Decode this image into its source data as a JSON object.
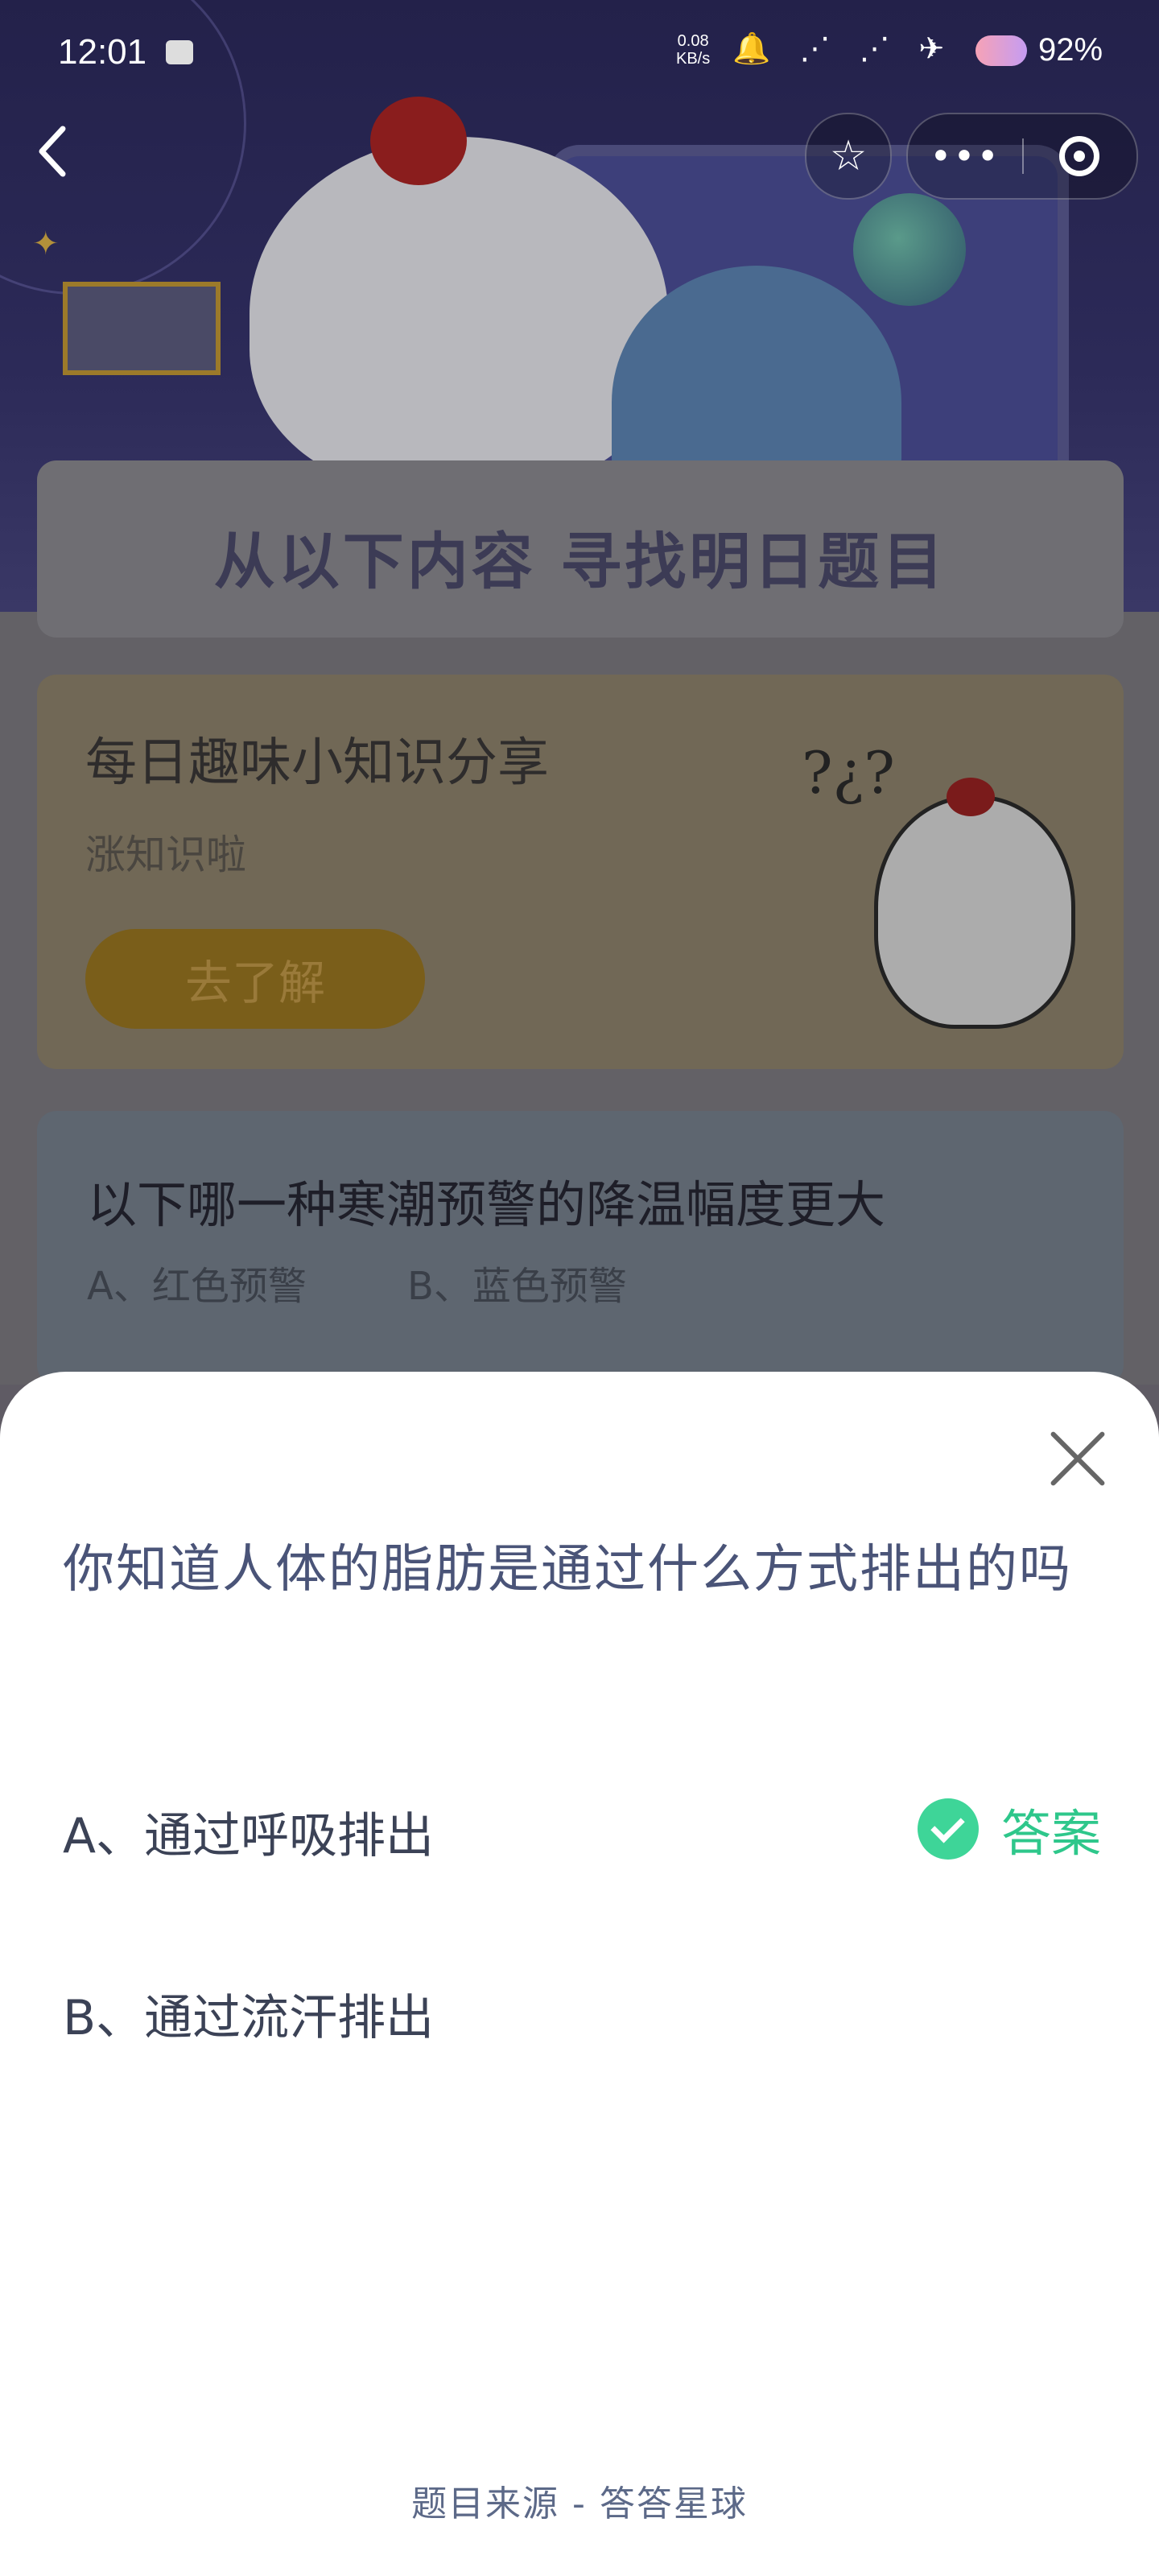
{
  "status_bar": {
    "time": "12:01",
    "net_speed_value": "0.08",
    "net_speed_unit": "KB/s",
    "battery": "92%"
  },
  "nav": {
    "back_icon": "chevron-left-icon",
    "favorite_icon": "star-icon",
    "more_icon": "more-dots-icon",
    "close_app_icon": "target-circle-icon"
  },
  "find_panel": {
    "title": "从以下内容 寻找明日题目"
  },
  "knowledge_card": {
    "title": "每日趣味小知识分享",
    "subtitle": "涨知识啦",
    "button_label": "去了解"
  },
  "question_card": {
    "question": "以下哪一种寒潮预警的降温幅度更大",
    "option_a": "A、红色预警",
    "option_b": "B、蓝色预警"
  },
  "answer_sheet": {
    "question": "你知道人体的脂肪是通过什么方式排出的吗",
    "options": [
      {
        "label": "A、通过呼吸排出",
        "is_answer": true
      },
      {
        "label": "B、通过流汗排出",
        "is_answer": false
      }
    ],
    "answer_tag": "答案",
    "source": "题目来源 - 答答星球"
  },
  "colors": {
    "accent_green": "#3ed598",
    "question_text": "#4a5478"
  }
}
